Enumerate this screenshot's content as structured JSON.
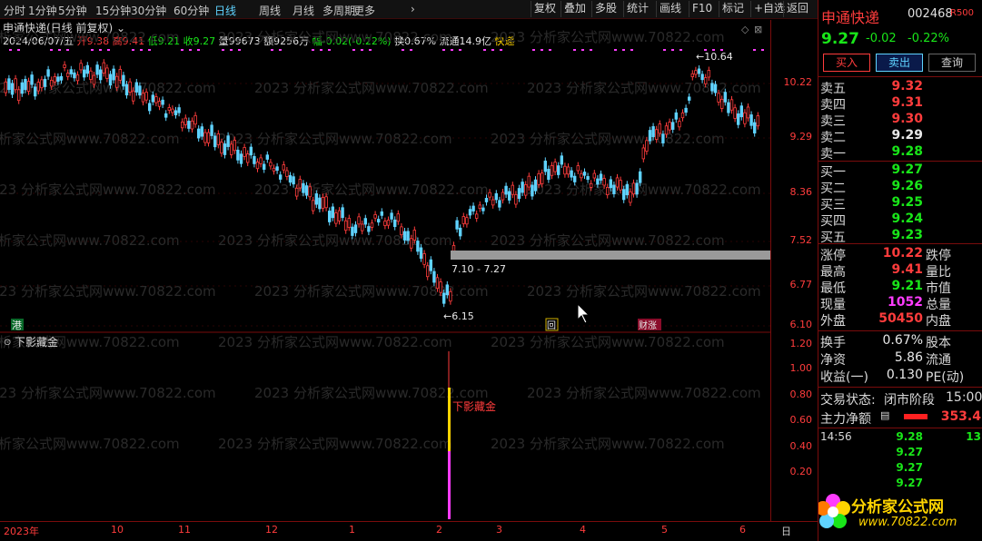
{
  "toolbar": {
    "periods": [
      "分时",
      "1分钟",
      "5分钟",
      "15分钟",
      "30分钟",
      "60分钟",
      "日线",
      "周线",
      "月线",
      "多周期",
      "更多"
    ],
    "buttons": [
      "复权",
      "叠加",
      "多股",
      "统计",
      "画线",
      "F10",
      "标记",
      "+自选",
      "返回"
    ]
  },
  "chart": {
    "title": "申通快递(日线 前复权)",
    "date": "2024/06/07/五",
    "open_l": "开",
    "open": "9.38",
    "high_l": "高",
    "high": "9.41",
    "low_l": "低",
    "low": "9.21",
    "close_l": "收",
    "close": "9.27",
    "vol_l": "量",
    "vol": "99673",
    "amt_l": "额",
    "amt": "9256万",
    "chg_l": "幅",
    "chg": "-0.02(-0.22%)",
    "turn_l": "换",
    "turn": "0.67%",
    "float_l": "流通",
    "float": "14.9亿",
    "tag": "快递",
    "price_ticks": [
      "10.22",
      "9.29",
      "8.36",
      "7.52",
      "6.77",
      "6.10"
    ],
    "annot_high": "10.64",
    "annot_low": "6.15",
    "annot_range": "7.10 - 7.27",
    "badges": {
      "hk": "港",
      "box": "回",
      "fin": "财涨"
    },
    "watermark": "2023 分析家公式网www.70822.com"
  },
  "indicator": {
    "title": "下影藏金",
    "label": "下影藏金",
    "ticks": [
      "1.20",
      "1.00",
      "0.80",
      "0.60",
      "0.40",
      "0.20"
    ]
  },
  "dates": [
    "2023年",
    "10",
    "11",
    "12",
    "1",
    "2",
    "3",
    "4",
    "5",
    "6",
    "日"
  ],
  "quote": {
    "name": "申通快递",
    "code": "002468",
    "badge": "R500",
    "price": "9.27",
    "chg": "-0.02",
    "pct": "-0.22%",
    "buy_btn": "买入",
    "sell_btn": "卖出",
    "query_btn": "查询",
    "asks": [
      {
        "label": "卖五",
        "price": "9.32"
      },
      {
        "label": "卖四",
        "price": "9.31"
      },
      {
        "label": "卖三",
        "price": "9.30"
      },
      {
        "label": "卖二",
        "price": "9.29"
      },
      {
        "label": "卖一",
        "price": "9.28"
      }
    ],
    "bids": [
      {
        "label": "买一",
        "price": "9.27"
      },
      {
        "label": "买二",
        "price": "9.26"
      },
      {
        "label": "买三",
        "price": "9.25"
      },
      {
        "label": "买四",
        "price": "9.24"
      },
      {
        "label": "买五",
        "price": "9.23"
      }
    ],
    "stats": [
      {
        "l": "涨停",
        "v": "10.22",
        "l2": "跌停"
      },
      {
        "l": "最高",
        "v": "9.41",
        "l2": "量比"
      },
      {
        "l": "最低",
        "v": "9.21",
        "l2": "市值"
      },
      {
        "l": "现量",
        "v": "1052",
        "l2": "总量"
      },
      {
        "l": "外盘",
        "v": "50450",
        "l2": "内盘"
      }
    ],
    "fund": [
      {
        "l": "换手",
        "v": "0.67%",
        "l2": "股本"
      },
      {
        "l": "净资",
        "v": "5.86",
        "l2": "流通"
      },
      {
        "l": "收益(一)",
        "v": "0.130",
        "l2": "PE(动)"
      }
    ],
    "state_l": "交易状态:",
    "state_v": "闭市阶段",
    "state_t": "15:00",
    "flow_l": "主力净额",
    "flow_v": "353.4",
    "ticks": [
      {
        "t": "14:56",
        "p": "9.28",
        "v": "13"
      },
      {
        "t": "",
        "p": "9.27",
        "v": ""
      },
      {
        "t": "",
        "p": "9.27",
        "v": ""
      },
      {
        "t": "",
        "p": "9.27",
        "v": ""
      }
    ],
    "logo": "分析家公式网",
    "logo_url": "www.70822.com"
  },
  "colors": {
    "up": "#ff3c3c",
    "down": "#5fd3ff",
    "bg": "#000000",
    "grid": "#7a0c0c"
  }
}
